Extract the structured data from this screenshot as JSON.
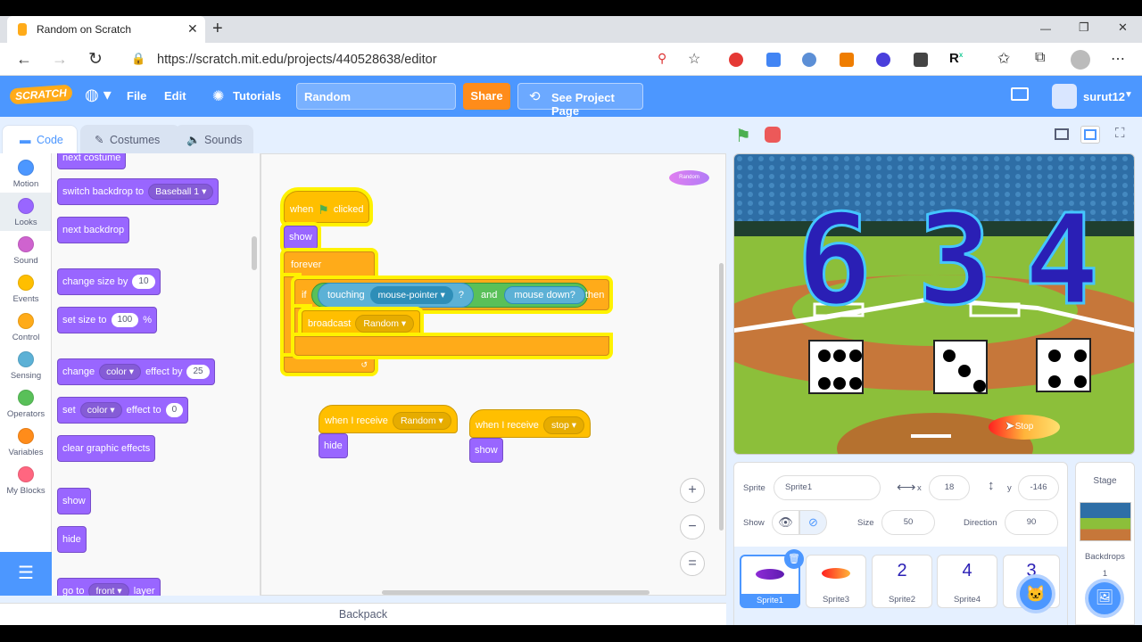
{
  "browser": {
    "tab_title": "Random on Scratch",
    "new_tab": "+",
    "url": "https://scratch.mit.edu/projects/440528638/editor",
    "window_controls": [
      "—",
      "❐",
      "✕"
    ]
  },
  "menu": {
    "logo": "SCRATCH",
    "file": "File",
    "edit": "Edit",
    "tutorials": "Tutorials",
    "project_title": "Random",
    "share": "Share",
    "see_project_page": "See Project Page",
    "username": "surut12"
  },
  "editor_tabs": {
    "code": "Code",
    "costumes": "Costumes",
    "sounds": "Sounds"
  },
  "categories": [
    {
      "label": "Motion",
      "color": "#4c97ff"
    },
    {
      "label": "Looks",
      "color": "#9966ff"
    },
    {
      "label": "Sound",
      "color": "#cf63cf"
    },
    {
      "label": "Events",
      "color": "#ffbf00"
    },
    {
      "label": "Control",
      "color": "#ffab19"
    },
    {
      "label": "Sensing",
      "color": "#5cb1d6"
    },
    {
      "label": "Operators",
      "color": "#59c059"
    },
    {
      "label": "Variables",
      "color": "#ff8c1a"
    },
    {
      "label": "My Blocks",
      "color": "#ff6680"
    }
  ],
  "palette": {
    "next_costume": "next costume",
    "switch_backdrop": "switch backdrop to",
    "backdrop_value": "Baseball 1",
    "next_backdrop": "next backdrop",
    "change_size": "change size by",
    "change_size_value": "10",
    "set_size": "set size to",
    "set_size_value": "100",
    "percent": "%",
    "change": "change",
    "effect_color": "color",
    "effect_by": "effect by",
    "effect_by_value": "25",
    "set": "set",
    "effect_to": "effect to",
    "effect_to_value": "0",
    "clear_effects": "clear graphic effects",
    "show": "show",
    "hide": "hide",
    "go_to": "go to",
    "front": "front",
    "layer": "layer"
  },
  "script": {
    "when": "when",
    "clicked": "clicked",
    "show": "show",
    "forever": "forever",
    "if": "if",
    "touching": "touching",
    "mouse_pointer": "mouse-pointer",
    "question": "?",
    "and": "and",
    "mouse_down": "mouse down?",
    "then": "then",
    "broadcast": "broadcast",
    "broadcast_msg": "Random",
    "when_receive_1": "when I receive",
    "msg1": "Random",
    "hide": "hide",
    "when_receive_2": "when I receive",
    "msg2": "stop",
    "show2": "show",
    "random_tag": "Random"
  },
  "zoom": {
    "in": "+",
    "out": "−",
    "reset": "="
  },
  "backpack": "Backpack",
  "stage_display": {
    "numbers": [
      "6",
      "3",
      "4"
    ],
    "dice": [
      6,
      3,
      4
    ],
    "stop_button": "Stop"
  },
  "sprite_info": {
    "sprite_label": "Sprite",
    "sprite_name": "Sprite1",
    "x_label": "x",
    "x": "18",
    "y_label": "y",
    "y": "-146",
    "show_label": "Show",
    "size_label": "Size",
    "size": "50",
    "direction_label": "Direction",
    "direction": "90"
  },
  "sprites": [
    {
      "name": "Sprite1",
      "selected": true
    },
    {
      "name": "Sprite3",
      "selected": false
    },
    {
      "name": "Sprite2",
      "selected": false
    },
    {
      "name": "Sprite4",
      "selected": false
    },
    {
      "name": "",
      "selected": false
    }
  ],
  "sprite_glyphs": [
    "2",
    "4",
    "3"
  ],
  "stage_panel": {
    "title": "Stage",
    "backdrops_label": "Backdrops",
    "backdrops_count": "1"
  }
}
